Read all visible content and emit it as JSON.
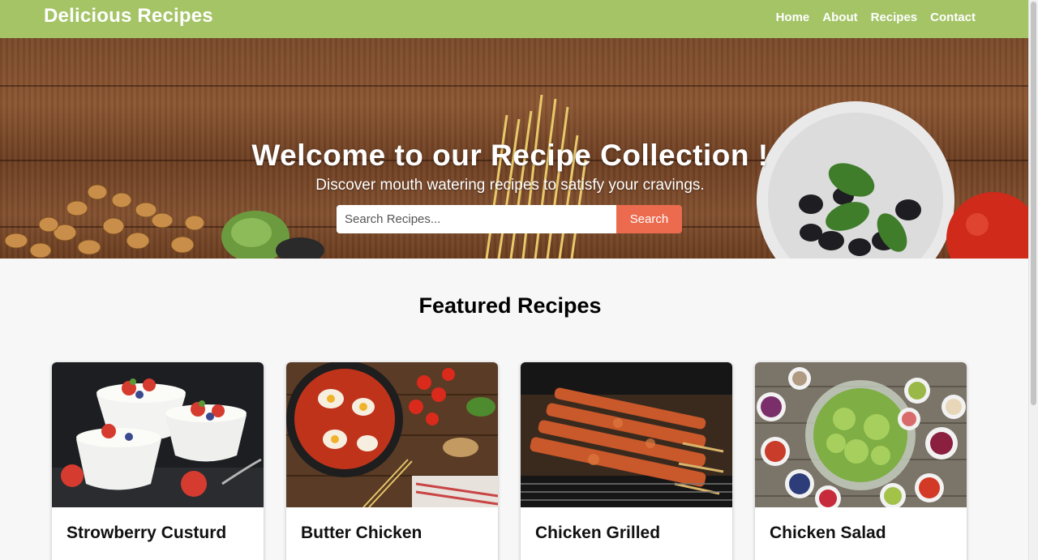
{
  "header": {
    "brand": "Delicious Recipes",
    "nav": [
      "Home",
      "About",
      "Recipes",
      "Contact"
    ]
  },
  "hero": {
    "title": "Welcome to our Recipe Collection !",
    "subtitle": "Discover mouth watering recipes to satisfy your cravings.",
    "search": {
      "placeholder": "Search Recipes...",
      "value": "",
      "button_label": "Search"
    }
  },
  "featured": {
    "title": "Featured Recipes",
    "cards": [
      {
        "title": "Strowberry Custurd",
        "image": "strawberry-custard-photo"
      },
      {
        "title": "Butter Chicken",
        "image": "butter-chicken-pan-photo"
      },
      {
        "title": "Chicken Grilled",
        "image": "grilled-chicken-skewers-photo"
      },
      {
        "title": "Chicken Salad",
        "image": "chicken-salad-bowls-photo"
      }
    ]
  },
  "colors": {
    "header_bg": "#a4c466",
    "search_button": "#ec6b4f",
    "page_bg": "#f7f7f7"
  }
}
